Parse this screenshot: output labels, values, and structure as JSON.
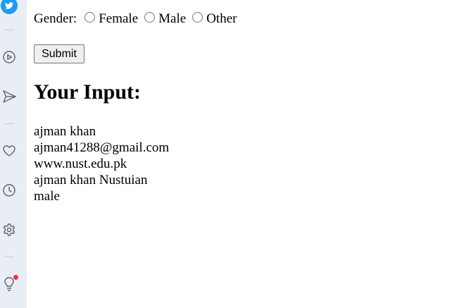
{
  "sidebar": {
    "icons": [
      "twitter-icon",
      "play-circle-icon",
      "send-icon",
      "heart-icon",
      "clock-icon",
      "gear-icon",
      "lightbulb-icon"
    ],
    "accent_color": "#1d9bf0",
    "notification_color": "#e8372c"
  },
  "form": {
    "gender_label": "Gender:",
    "options": [
      "Female",
      "Male",
      "Other"
    ],
    "submit_label": "Submit"
  },
  "output": {
    "heading": "Your Input:",
    "lines": [
      "ajman khan",
      "ajman41288@gmail.com",
      "www.nust.edu.pk",
      "ajman khan Nustuian",
      "male"
    ]
  }
}
